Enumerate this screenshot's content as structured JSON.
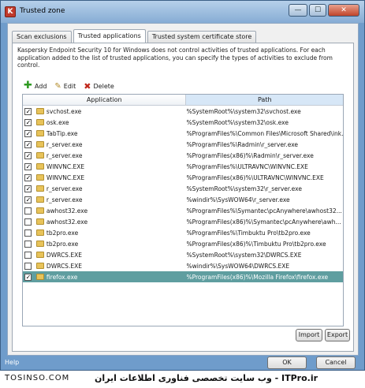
{
  "window": {
    "title": "Trusted zone",
    "minimize_glyph": "—",
    "maximize_glyph": "☐",
    "close_glyph": "✕"
  },
  "tabs": [
    {
      "label": "Scan exclusions",
      "active": false
    },
    {
      "label": "Trusted applications",
      "active": true
    },
    {
      "label": "Trusted system certificate store",
      "active": false
    }
  ],
  "description": "Kaspersky Endpoint Security 10 for Windows does not control activities of trusted applications. For each application added to the list of trusted applications, you can specify the types of activities to exclude from control.",
  "toolbar": {
    "add_label": "Add",
    "edit_label": "Edit",
    "delete_label": "Delete"
  },
  "grid": {
    "headers": {
      "application": "Application",
      "path": "Path"
    },
    "rows": [
      {
        "checked": true,
        "app": "svchost.exe",
        "path": "%SystemRoot%\\system32\\svchost.exe"
      },
      {
        "checked": true,
        "app": "osk.exe",
        "path": "%SystemRoot%\\system32\\osk.exe"
      },
      {
        "checked": true,
        "app": "TabTip.exe",
        "path": "%ProgramFiles%\\Common Files\\Microsoft Shared\\ink..."
      },
      {
        "checked": true,
        "app": "r_server.exe",
        "path": "%ProgramFiles%\\Radmin\\r_server.exe"
      },
      {
        "checked": true,
        "app": "r_server.exe",
        "path": "%ProgramFiles(x86)%\\Radmin\\r_server.exe"
      },
      {
        "checked": true,
        "app": "WINVNC.EXE",
        "path": "%ProgramFiles%\\ULTRAVNC\\WINVNC.EXE"
      },
      {
        "checked": true,
        "app": "WINVNC.EXE",
        "path": "%ProgramFiles(x86)%\\ULTRAVNC\\WINVNC.EXE"
      },
      {
        "checked": true,
        "app": "r_server.exe",
        "path": "%SystemRoot%\\system32\\r_server.exe"
      },
      {
        "checked": true,
        "app": "r_server.exe",
        "path": "%windir%\\SysWOW64\\r_server.exe"
      },
      {
        "checked": false,
        "app": "awhost32.exe",
        "path": "%ProgramFiles%\\Symantec\\pcAnywhere\\awhost32..."
      },
      {
        "checked": false,
        "app": "awhost32.exe",
        "path": "%ProgramFiles(x86)%\\Symantec\\pcAnywhere\\awh..."
      },
      {
        "checked": false,
        "app": "tb2pro.exe",
        "path": "%ProgramFiles%\\Timbuktu Pro\\tb2pro.exe"
      },
      {
        "checked": false,
        "app": "tb2pro.exe",
        "path": "%ProgramFiles(x86)%\\Timbuktu Pro\\tb2pro.exe"
      },
      {
        "checked": false,
        "app": "DWRCS.EXE",
        "path": "%SystemRoot%\\system32\\DWRCS.EXE"
      },
      {
        "checked": false,
        "app": "DWRCS.EXE",
        "path": "%windir%\\SysWOW64\\DWRCS.EXE"
      },
      {
        "checked": true,
        "app": "firefox.exe",
        "path": "%ProgramFiles(x86)%\\Mozilla Firefox\\firefox.exe",
        "selected": true
      }
    ]
  },
  "buttons": {
    "import_label": "Import",
    "export_label": "Export",
    "ok_label": "OK",
    "cancel_label": "Cancel"
  },
  "help_label": "Help",
  "watermark": {
    "left": "TOSINSO.COM",
    "right": "ITPro.ir - وب سایت تخصصی فناوری اطلاعات ایران"
  },
  "colors": {
    "selected_row": "#5f9ea0",
    "window_frame": "#6f9ccb"
  }
}
